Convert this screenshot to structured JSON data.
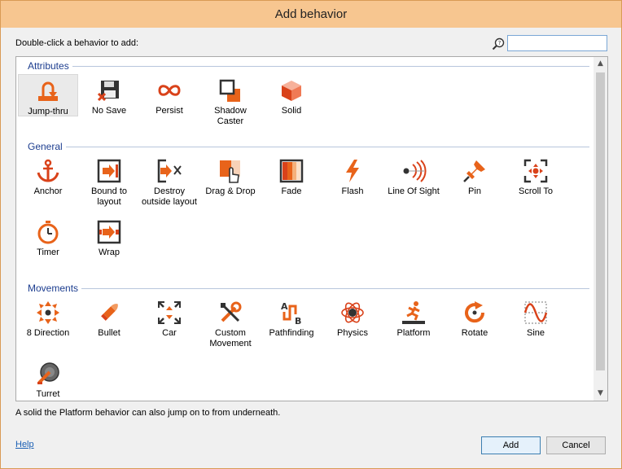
{
  "window": {
    "title": "Add behavior"
  },
  "prompt": "Double-click a behavior to add:",
  "search": {
    "value": "",
    "placeholder": ""
  },
  "groups": [
    {
      "title": "Attributes",
      "items": [
        "Jump-thru",
        "No Save",
        "Persist",
        "Shadow\nCaster",
        "Solid"
      ]
    },
    {
      "title": "General",
      "items": [
        "Anchor",
        "Bound to\nlayout",
        "Destroy\noutside layout",
        "Drag & Drop",
        "Fade",
        "Flash",
        "Line Of Sight",
        "Pin",
        "Scroll To",
        "Timer",
        "Wrap"
      ]
    },
    {
      "title": "Movements",
      "items": [
        "8 Direction",
        "Bullet",
        "Car",
        "Custom\nMovement",
        "Pathfinding",
        "Physics",
        "Platform",
        "Rotate",
        "Sine",
        "Turret"
      ]
    }
  ],
  "selected_item": "Jump-thru",
  "description": "A solid the Platform behavior can also jump on to from underneath.",
  "footer": {
    "help_label": "Help",
    "add_label": "Add",
    "cancel_label": "Cancel"
  },
  "icons": {
    "jump-thru": "jump-thru-icon",
    "no-save": "no-save-icon",
    "persist": "infinity-icon",
    "shadow-caster": "shadow-caster-icon",
    "solid": "cube-icon",
    "anchor": "anchor-icon",
    "bound": "bound-to-layout-icon",
    "destroy": "destroy-outside-icon",
    "drag": "drag-drop-icon",
    "fade": "fade-icon",
    "flash": "lightning-icon",
    "los": "line-of-sight-icon",
    "pin": "pushpin-icon",
    "scroll": "scroll-to-icon",
    "timer": "stopwatch-icon",
    "wrap": "wrap-icon"
  },
  "colors": {
    "accent": "#e8631a",
    "title_bar": "#f7c690",
    "group_title": "#1c3d8f"
  }
}
